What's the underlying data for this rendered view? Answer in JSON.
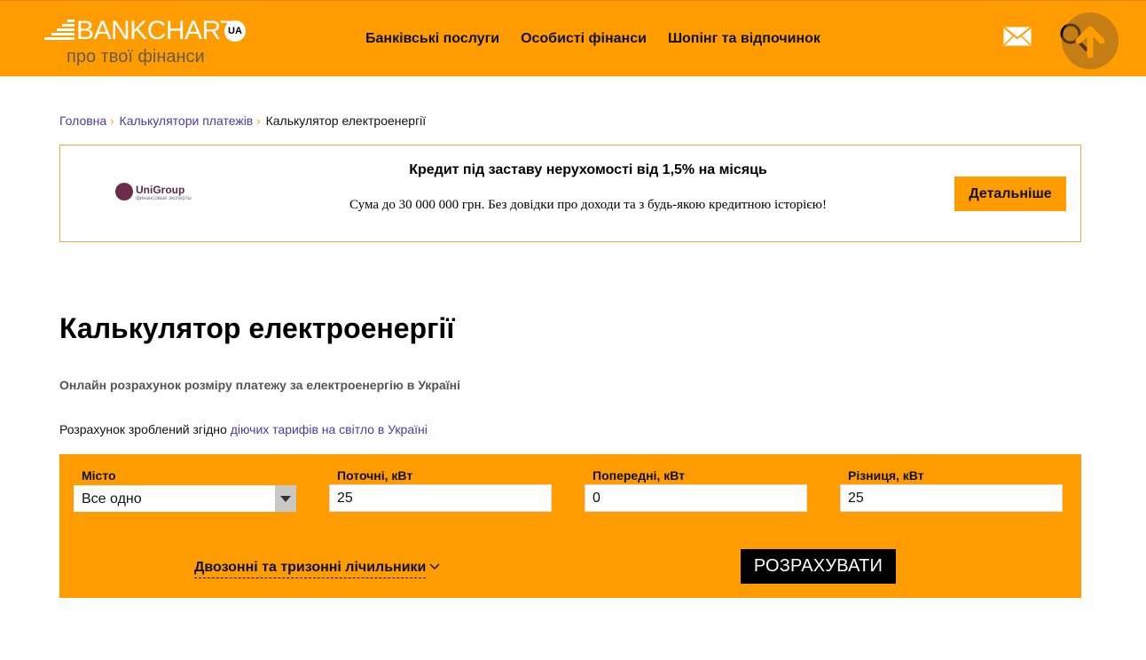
{
  "header": {
    "logo_text": "BANKCHART",
    "logo_badge": "UA",
    "tagline": "про твої фінанси",
    "nav": [
      {
        "label": "Банківські послуги"
      },
      {
        "label": "Особисті фінанси"
      },
      {
        "label": "Шопінг та відпочинок"
      }
    ],
    "icons": [
      "mail-icon",
      "search-icon",
      "scroll-top-icon"
    ]
  },
  "breadcrumb": {
    "items": [
      {
        "label": "Головна",
        "link": true
      },
      {
        "label": "Калькулятори платежів",
        "link": true
      },
      {
        "label": "Калькулятор електроенергії",
        "link": false
      }
    ],
    "separator": "›"
  },
  "ad": {
    "logo_name": "UniGroup",
    "logo_sub": "финансовые эксперты",
    "title": "Кредит під заставу нерухомості від 1,5% на місяць",
    "description": "Сума до 30 000 000 грн. Без довідки про доходи та з будь-якою кредитною історією!",
    "button_label": "Детальніше"
  },
  "page": {
    "title": "Калькулятор електроенергії",
    "subtitle": "Онлайн розрахунок розміру платежу за електроенергію в Україні",
    "note_prefix": "Розрахунок зроблений згідно",
    "note_link": "діючих тарифів на світло в Україні"
  },
  "calculator": {
    "city_label": "Місто",
    "city_value": "Все одно",
    "current_label": "Поточні, кВт",
    "current_value": "25",
    "previous_label": "Попередні, кВт",
    "previous_value": "0",
    "diff_label": "Різниця, кВт",
    "diff_value": "25",
    "toggle_label": "Двозонні та тризонні лічильники",
    "calc_button": "РОЗРАХУВАТИ"
  },
  "colors": {
    "accent": "#ff9c00",
    "link": "#4a3aa8",
    "button_dark": "#000000"
  }
}
